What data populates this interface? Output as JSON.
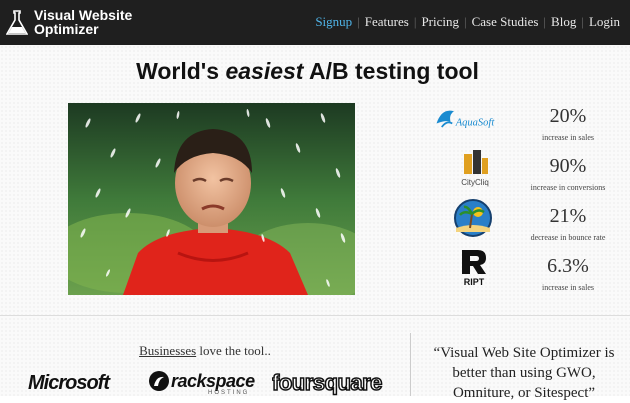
{
  "header": {
    "logo_line1": "Visual Website",
    "logo_line2": "Optimizer",
    "nav": [
      {
        "label": "Signup",
        "active": true
      },
      {
        "label": "Features",
        "active": false
      },
      {
        "label": "Pricing",
        "active": false
      },
      {
        "label": "Case Studies",
        "active": false
      },
      {
        "label": "Blog",
        "active": false
      },
      {
        "label": "Login",
        "active": false
      }
    ]
  },
  "hero": {
    "headline_pre": "World's ",
    "headline_em": "easiest",
    "headline_post": " A/B testing tool"
  },
  "stats": [
    {
      "logo": "AquaSoft",
      "value": "20%",
      "label": "increase in sales"
    },
    {
      "logo": "CityCliq",
      "value": "90%",
      "label": "increase in conversions"
    },
    {
      "logo": "beach-logo",
      "value": "21%",
      "label": "decrease in bounce rate"
    },
    {
      "logo": "RIPT",
      "value": "6.3%",
      "label": "increase in sales"
    }
  ],
  "businesses": {
    "link": "Businesses",
    "rest": " love the tool..",
    "logos": [
      "Microsoft",
      "rackspace",
      "foursquare"
    ],
    "rackspace_sub": "HOSTING"
  },
  "quote": {
    "line1": "“Visual Web Site Optimizer is",
    "line2": "better than using GWO,",
    "line3": "Omniture, or Sitespect”"
  }
}
